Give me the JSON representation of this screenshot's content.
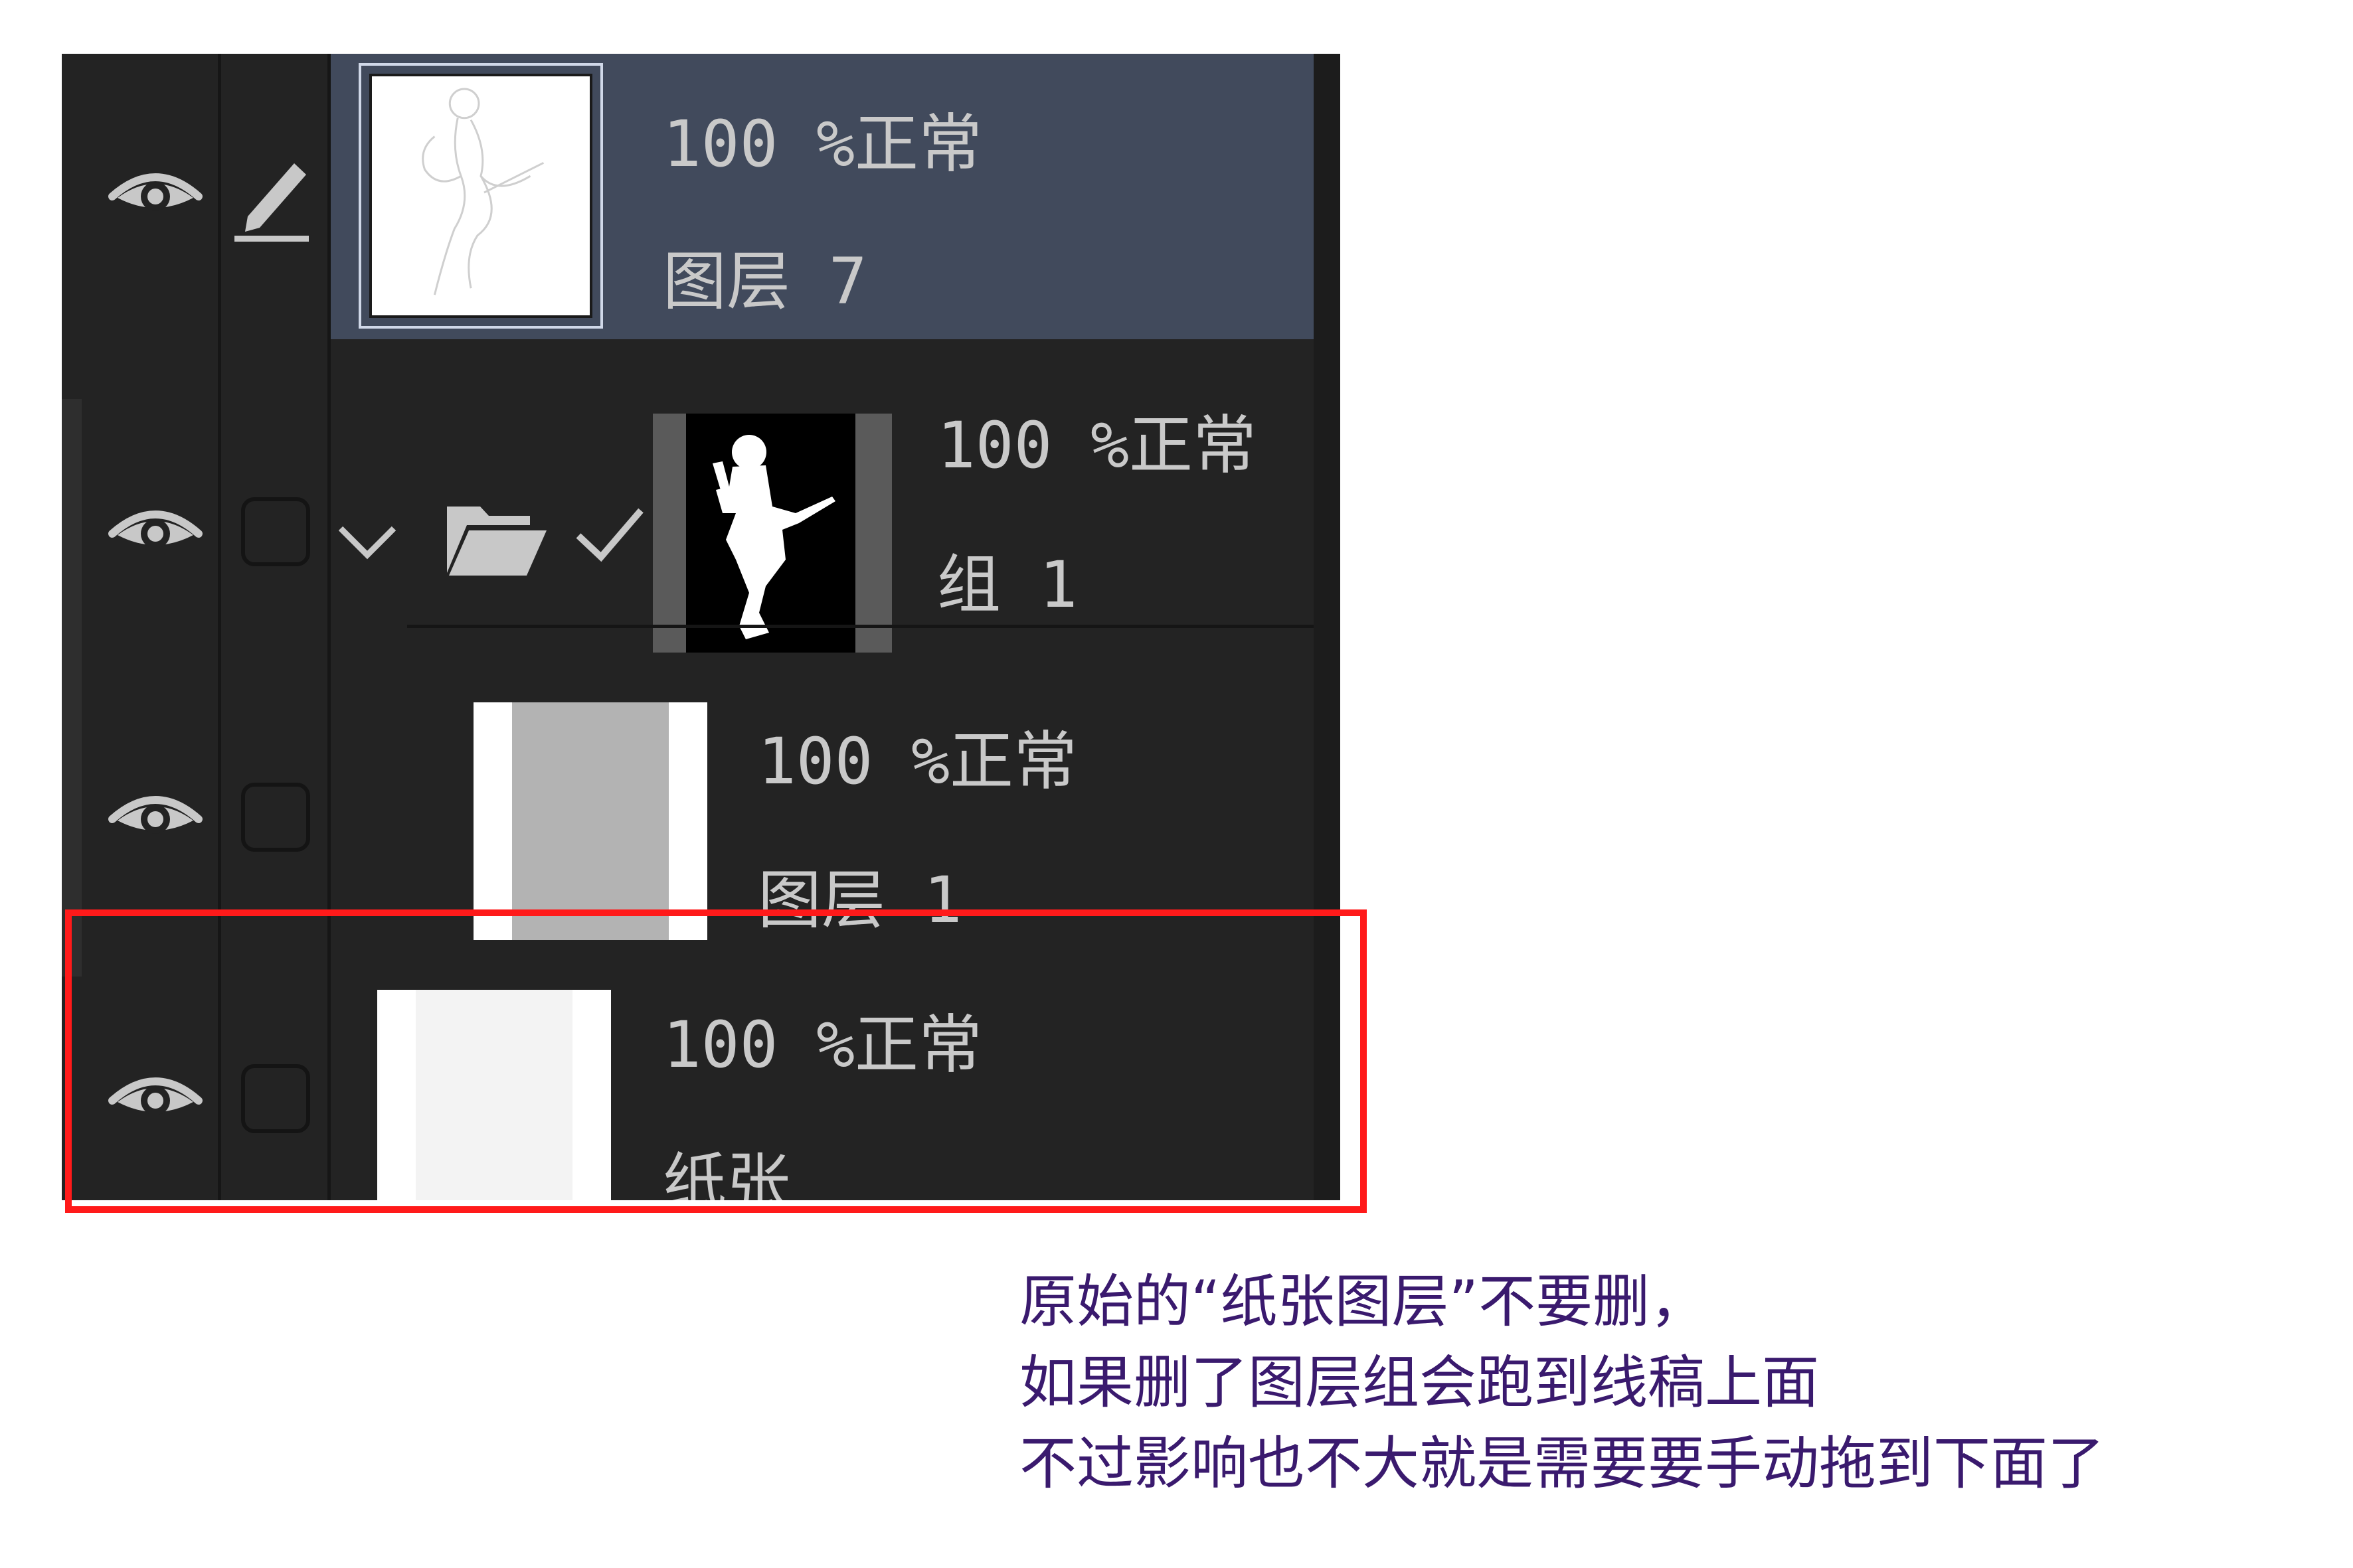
{
  "layers": [
    {
      "id": "layer7",
      "opacity_mode": "100 %正常",
      "name": "图层 7",
      "selected": true,
      "editing": true,
      "visible": true
    },
    {
      "id": "group1",
      "opacity_mode": "100 %正常",
      "name": "组 1",
      "selected": false,
      "expanded": true,
      "visible": true,
      "type": "folder"
    },
    {
      "id": "layer1",
      "opacity_mode": "100 %正常",
      "name": "图层 1",
      "selected": false,
      "visible": true
    },
    {
      "id": "paper",
      "opacity_mode": "100 %正常",
      "name": "纸张",
      "selected": false,
      "visible": true
    }
  ],
  "icons": {
    "eye": "eye-icon",
    "pen": "pen-edit-icon",
    "chevron": "chevron-down-icon",
    "folder": "open-folder-icon",
    "check": "checkmark-icon"
  },
  "colors": {
    "panel_bg": "#232323",
    "selected_row_bg": "#414a5c",
    "highlight_border": "#ff1a1a",
    "note_text": "#3a1a6e"
  },
  "note": {
    "line1": "原始的“纸张图层”不要删，",
    "line2": "如果删了图层组会跑到线稿上面",
    "line3": "不过影响也不大就是需要要手动拖到下面了"
  }
}
